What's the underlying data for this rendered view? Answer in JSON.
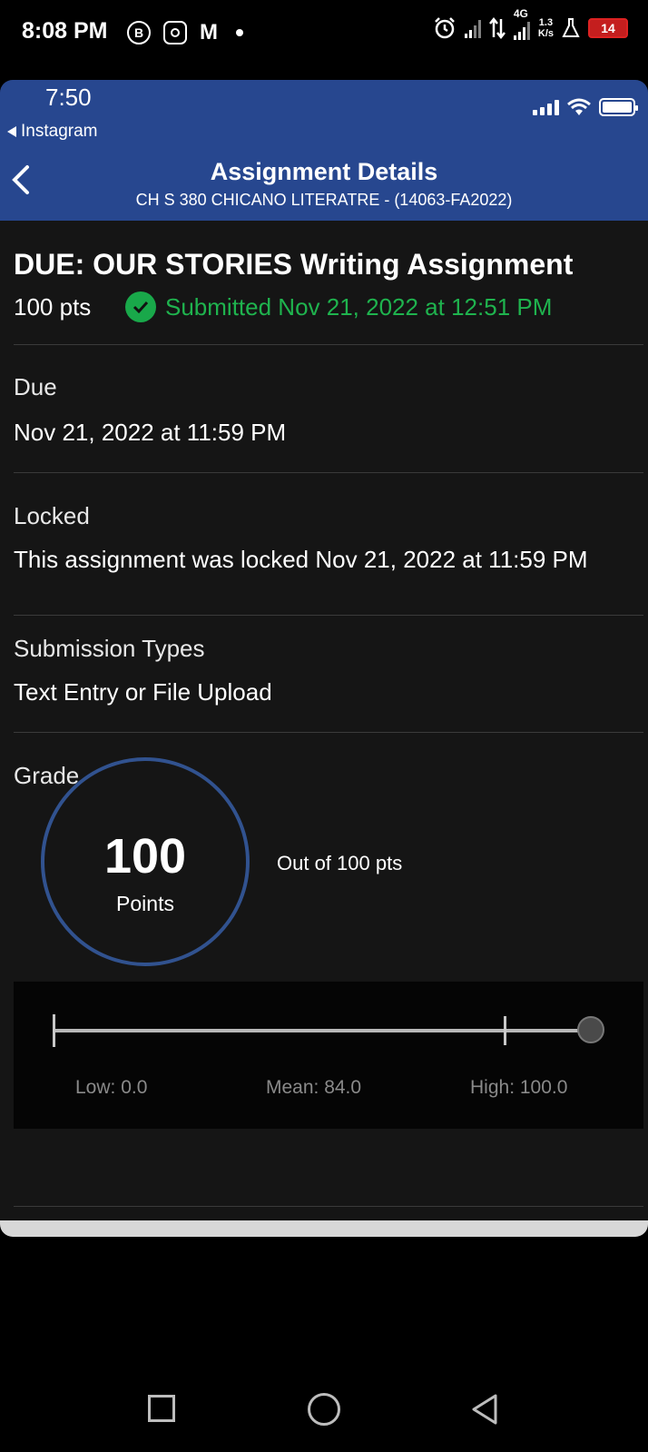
{
  "android_status": {
    "time": "8:08 PM",
    "notif_icons": [
      "b-icon",
      "instagram-icon",
      "gmail-icon",
      "dot"
    ],
    "net_type": "4G",
    "net_speed_value": "1.3",
    "net_speed_unit": "K/s",
    "battery": "14"
  },
  "ios_status": {
    "time": "7:50",
    "back_app": "Instagram"
  },
  "nav": {
    "title": "Assignment Details",
    "subtitle": "CH S 380 CHICANO LITERATRE - (14063-FA2022)"
  },
  "assignment": {
    "title": "DUE: OUR STORIES Writing Assignment",
    "points": "100 pts",
    "submitted": "Submitted Nov 21, 2022 at 12:51 PM"
  },
  "sections": {
    "due_label": "Due",
    "due_value": "Nov 21, 2022 at 11:59 PM",
    "locked_label": "Locked",
    "locked_value": "This assignment was locked Nov 21, 2022 at 11:59 PM",
    "submission_types_label": "Submission Types",
    "submission_types_value": "Text Entry or File Upload",
    "grade_label": "Grade"
  },
  "grade": {
    "score": "100",
    "unit": "Points",
    "out_of": "Out of 100 pts"
  },
  "stats": {
    "low_label": "Low: 0.0",
    "mean_label": "Mean: 84.0",
    "high_label": "High: 100.0",
    "low": 0.0,
    "mean": 84.0,
    "high": 100.0,
    "score": 100
  },
  "colors": {
    "header_blue": "#27478f",
    "submitted_green": "#1fb34e",
    "grade_ring": "#31528f"
  }
}
